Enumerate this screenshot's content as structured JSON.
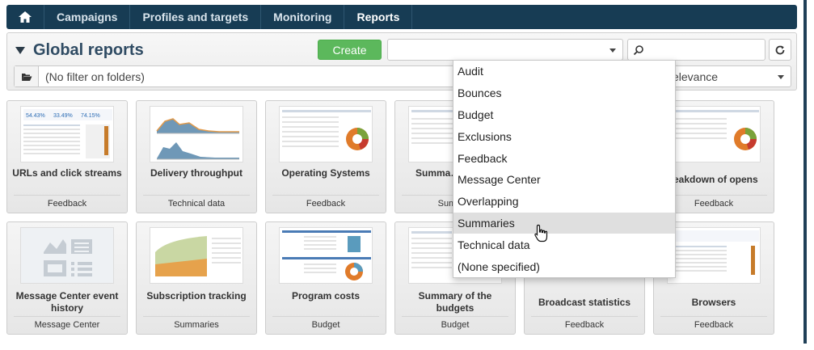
{
  "nav": {
    "tabs": [
      "Campaigns",
      "Profiles and targets",
      "Monitoring",
      "Reports"
    ],
    "active_tab": "Reports"
  },
  "header": {
    "title": "Global reports",
    "create_label": "Create",
    "folder_filter": "(No filter on folders)",
    "sort_value": "elevance"
  },
  "cards": [
    {
      "name": "URLs and click streams",
      "category": "Feedback"
    },
    {
      "name": "Delivery throughput",
      "category": "Technical data"
    },
    {
      "name": "Operating Systems",
      "category": "Feedback"
    },
    {
      "name": "Summa… deliv…",
      "category": "Summ…"
    },
    {
      "name": "",
      "category": ""
    },
    {
      "name": "reakdown of opens",
      "category": "Feedback"
    },
    {
      "name": "Message Center event history",
      "category": "Message Center"
    },
    {
      "name": "Subscription tracking",
      "category": "Summaries"
    },
    {
      "name": "Program costs",
      "category": "Budget"
    },
    {
      "name": "Summary of the budgets",
      "category": "Budget"
    },
    {
      "name": "Broadcast statistics",
      "category": "Feedback"
    },
    {
      "name": "Browsers",
      "category": "Feedback"
    }
  ],
  "dropdown": {
    "options": [
      "Audit",
      "Bounces",
      "Budget",
      "Exclusions",
      "Feedback",
      "Message Center",
      "Overlapping",
      "Summaries",
      "Technical data",
      "(None specified)"
    ],
    "hovered": "Summaries"
  },
  "colors": {
    "nav_bg": "#173c54",
    "create_green": "#5cb85c",
    "title_blue": "#2f4b63"
  }
}
